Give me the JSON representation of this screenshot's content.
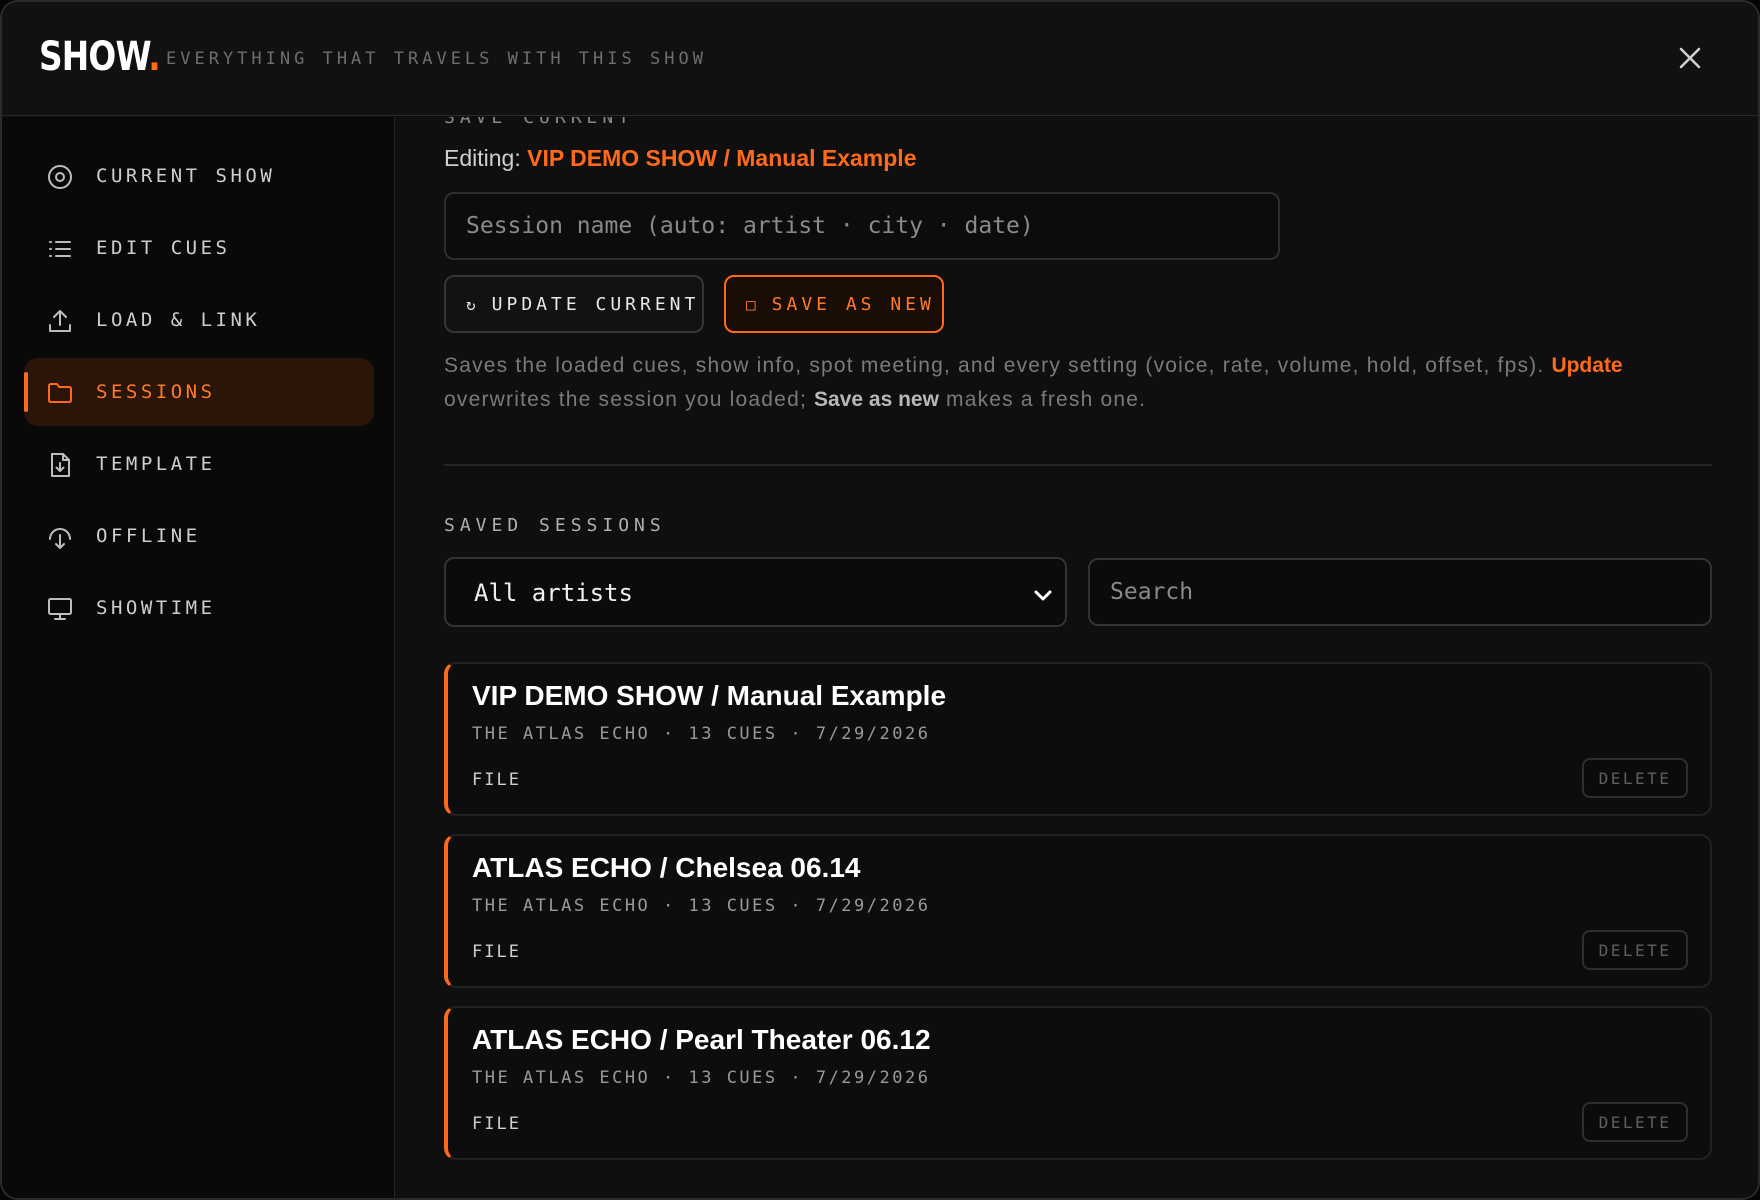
{
  "app": {
    "logo_text": "SHOW",
    "logo_dot": ".",
    "tagline": "EVERYTHING THAT TRAVELS WITH THIS SHOW",
    "close_icon": "close-icon"
  },
  "sidebar": {
    "items": [
      {
        "label": "CURRENT SHOW",
        "icon": "target-icon",
        "active": false
      },
      {
        "label": "EDIT CUES",
        "icon": "list-icon",
        "active": false
      },
      {
        "label": "LOAD & LINK",
        "icon": "upload-icon",
        "active": false
      },
      {
        "label": "SESSIONS",
        "icon": "folder-icon",
        "active": true
      },
      {
        "label": "TEMPLATE",
        "icon": "file-download-icon",
        "active": false
      },
      {
        "label": "OFFLINE",
        "icon": "cloud-download-icon",
        "active": false
      },
      {
        "label": "SHOWTIME",
        "icon": "monitor-icon",
        "active": false
      }
    ]
  },
  "save_current": {
    "heading": "SAVE CURRENT",
    "editing_label": "Editing:",
    "editing_value": "VIP DEMO SHOW / Manual Example",
    "name_placeholder": "Session name (auto: artist · city · date)",
    "name_value": "",
    "update_icon": "↻",
    "update_label": "UPDATE CURRENT",
    "save_icon": "□",
    "save_label": "SAVE AS NEW",
    "help_text_1": "Saves the loaded cues, show info, spot meeting, and every setting (voice, rate, volume, hold, offset, fps).",
    "help_update": "Update",
    "help_text_2": "overwrites the session you loaded;",
    "help_save_as_new": "Save as new",
    "help_text_3": "makes a fresh one."
  },
  "saved_sessions": {
    "title": "SAVED SESSIONS",
    "artist_filter": "All artists",
    "search_placeholder": "Search",
    "search_value": "",
    "sessions": [
      {
        "title": "VIP DEMO SHOW / Manual Example",
        "meta": "THE ATLAS ECHO · 13 CUES · 7/29/2026",
        "type": "FILE",
        "delete_label": "DELETE"
      },
      {
        "title": "ATLAS ECHO / Chelsea 06.14",
        "meta": "THE ATLAS ECHO · 13 CUES · 7/29/2026",
        "type": "FILE",
        "delete_label": "DELETE"
      },
      {
        "title": "ATLAS ECHO / Pearl Theater 06.12",
        "meta": "THE ATLAS ECHO · 13 CUES · 7/29/2026",
        "type": "FILE",
        "delete_label": "DELETE"
      }
    ]
  },
  "colors": {
    "accent": "#ff6a1a",
    "background": "#0f0f0f",
    "sidebar_bg": "#090909",
    "active_bg": "#2a1508"
  }
}
